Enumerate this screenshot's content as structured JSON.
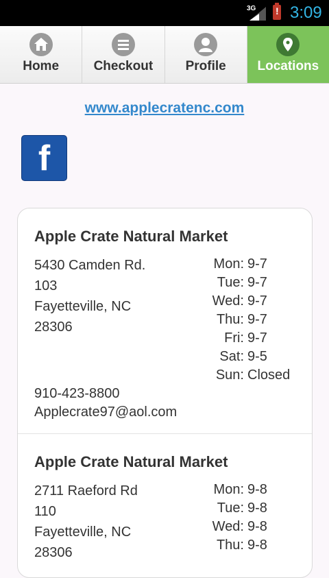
{
  "status_bar": {
    "network": "3G",
    "time": "3:09"
  },
  "nav": {
    "tabs": [
      {
        "label": "Home",
        "icon": "home-icon",
        "active": false
      },
      {
        "label": "Checkout",
        "icon": "menu-lines-icon",
        "active": false
      },
      {
        "label": "Profile",
        "icon": "user-icon",
        "active": false
      },
      {
        "label": "Locations",
        "icon": "map-pin-icon",
        "active": true
      }
    ],
    "active_color": "#7cc35a"
  },
  "website": {
    "label": "www.applecratenc.com"
  },
  "facebook": {
    "icon": "facebook-icon",
    "letter": "f"
  },
  "locations": [
    {
      "name": "Apple Crate Natural Market",
      "address": [
        "5430 Camden Rd.",
        "103",
        "Fayetteville, NC",
        "28306"
      ],
      "hours": [
        {
          "day": "Mon:",
          "time": "9-7"
        },
        {
          "day": "Tue:",
          "time": "9-7"
        },
        {
          "day": "Wed:",
          "time": "9-7"
        },
        {
          "day": "Thu:",
          "time": "9-7"
        },
        {
          "day": "Fri:",
          "time": "9-7"
        },
        {
          "day": "Sat:",
          "time": "9-5"
        },
        {
          "day": "Sun:",
          "time": "Closed"
        }
      ],
      "phone": "910-423-8800",
      "email": "Applecrate97@aol.com"
    },
    {
      "name": "Apple Crate Natural Market",
      "address": [
        "2711 Raeford Rd",
        "110",
        "Fayetteville, NC",
        "28306"
      ],
      "hours": [
        {
          "day": "Mon:",
          "time": "9-8"
        },
        {
          "day": "Tue:",
          "time": "9-8"
        },
        {
          "day": "Wed:",
          "time": "9-8"
        },
        {
          "day": "Thu:",
          "time": "9-8"
        }
      ]
    }
  ]
}
